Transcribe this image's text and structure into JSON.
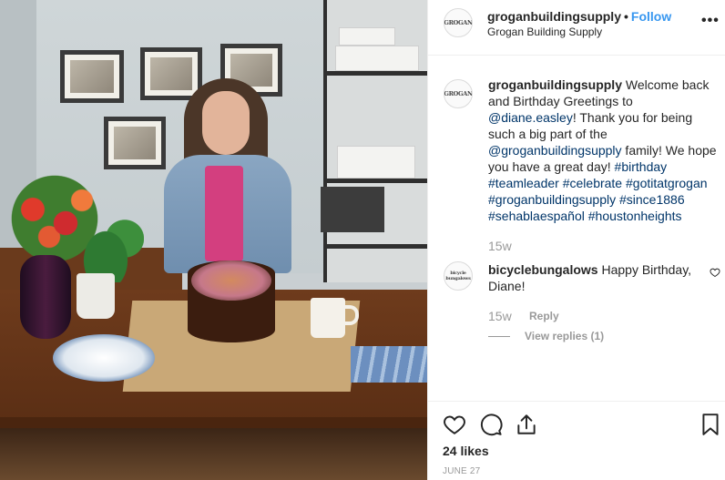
{
  "header": {
    "username": "groganbuildingsupply",
    "separator": "•",
    "follow_label": "Follow",
    "subtitle": "Grogan Building Supply",
    "more_label": "•••",
    "avatar_text": "GROGAN"
  },
  "caption": {
    "username": "groganbuildingsupply",
    "t1": " Welcome back and Birthday Greetings to ",
    "mention1": "@diane.easley",
    "t2": "! Thank you for being such a big part of the ",
    "mention2": "@groganbuildingsupply",
    "t3": " family! We hope you have a great day! ",
    "tags": [
      "#birthday",
      "#teamleader",
      "#celebrate",
      "#gotitatgrogan",
      "#groganbuildingsupply",
      "#since1886",
      "#sehablaespañol",
      "#houstonheights"
    ],
    "timestamp": "15w"
  },
  "comment": {
    "avatar_text": "bicycle bungalows",
    "username": "bicyclebungalows",
    "text": " Happy Birthday, Diane!",
    "timestamp": "15w",
    "reply_label": "Reply",
    "view_replies_label": "View replies (1)"
  },
  "footer": {
    "likes": "24 likes",
    "date": "JUNE 27"
  },
  "icons": [
    "heart-icon",
    "comment-icon",
    "share-icon",
    "bookmark-icon",
    "more-icon"
  ],
  "colors": {
    "link": "#3897f0",
    "hashtag": "#003569",
    "muted": "#999999",
    "text": "#262626"
  }
}
